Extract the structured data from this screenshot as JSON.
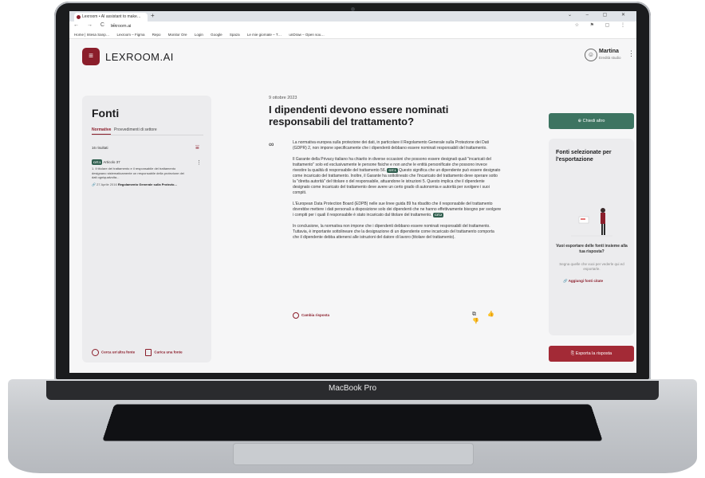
{
  "device": {
    "label": "MacBook Pro"
  },
  "browser": {
    "tab_title": "Lexroom • AI assistant to make…",
    "new_tab": "+",
    "window_controls": "⌄ – ▢ ✕",
    "nav_icons": "← → C ⌂",
    "url": "lexroom.ai",
    "toolbar_icons": "☆ ⚑ ▢ ⋮",
    "bookmarks": [
      "Home | Intesa Sanp…",
      "Lexroom – Figma",
      "Repo",
      "Monitor Ore",
      "Login",
      "Google",
      "Spaza",
      "Le mie giornate – T…",
      "unDraw – Open sou…"
    ]
  },
  "header": {
    "menu_icon": "≡",
    "logo": "LEXROOM.AI",
    "user_name": "Martina",
    "user_role": "Eredità studio",
    "menu_kebab": "⋮"
  },
  "sources": {
    "title": "Fonti",
    "tabs": [
      "Normative",
      "Provvedimenti di settore"
    ],
    "results_count": "16 risultati",
    "card": {
      "badge": "CIT.1",
      "article": "Articolo 37",
      "text": "1. Il titolare del trattamento e il responsabile del trattamento designano sistematicamente un responsabile della protezione dei dati ogniqualvolta...",
      "date": "27 Aprile 2016",
      "source": "Regolamento Generale sulla Protezio..."
    },
    "search_other": "Cerca un'altra fonte",
    "upload": "Carica una fonte"
  },
  "article": {
    "date": "9 ottobre 2023",
    "title": "I dipendenti devono essere nominati responsabili del trattamento?",
    "paragraphs": [
      {
        "text": "La normativa europea sulla protezione dei dati, in particolare il Regolamento Generale sulla Protezione dei Dati (GDPR) 2, non impone specificamente che i dipendenti debbano essere nominati responsabili del trattamento.",
        "cit": ""
      },
      {
        "text": "Il Garante della Privacy italiano ha chiarito in diverse occasioni che possono essere designati quali \"incaricati del trattamento\" solo ed esclusivamente le persone fisiche e non anche le entità personificate che possono invece rivestire la qualità di responsabile del trattamento 56.",
        "cit": "CIT.1",
        "after": "Questo significa che un dipendente può essere designato come incaricato del trattamento. Inoltre, il Garante ha sottolineato che l'incaricato del trattamento deve operare sotto la \"diretta autorità\" del titolare o del responsabile, attuandone le istruzioni 5. Questo implica che il dipendente designato come incaricato del trattamento deve avere un certo grado di autonomia e autorità per svolgere i suoi compiti."
      },
      {
        "text": "L'European Data Protection Board (EDPB) nelle sue linee guida 89 ha ribadito che il responsabile del trattamento dovrebbe mettere i dati personali a disposizione solo dei dipendenti che ne hanno effettivamente bisogno per svolgere i compiti per i quali il responsabile è stato incaricato dal titolare del trattamento.",
        "cit": "CIT.2"
      },
      {
        "text": "In conclusione, la normativa non impone che i dipendenti debbano essere nominati responsabili del trattamento. Tuttavia, è importante sottolineare che la designazione di un dipendente come incaricato del trattamento comporta che il dipendente debba attenersi alle istruzioni del datore di lavoro (titolare del trattamento).",
        "cit": ""
      }
    ],
    "change_answer": "Cambia risposta",
    "feedback_icons": "⧉ 👍 👎"
  },
  "export_panel": {
    "ask_more": "Chiedi altro",
    "title": "Fonti selezionate per l'esportazione",
    "question": "Vuoi esportare delle fonti insieme alla tua risposta?",
    "hint": "Segna quelle che vuoi per vederle qui ed esportarle.",
    "add_cited": "Aggiungi fonti citate",
    "export": "Esporta la risposta"
  },
  "colors": {
    "brand": "#8b1e2b",
    "accent_green": "#3d7461",
    "citation": "#2f5e4e",
    "export": "#a32a36"
  }
}
